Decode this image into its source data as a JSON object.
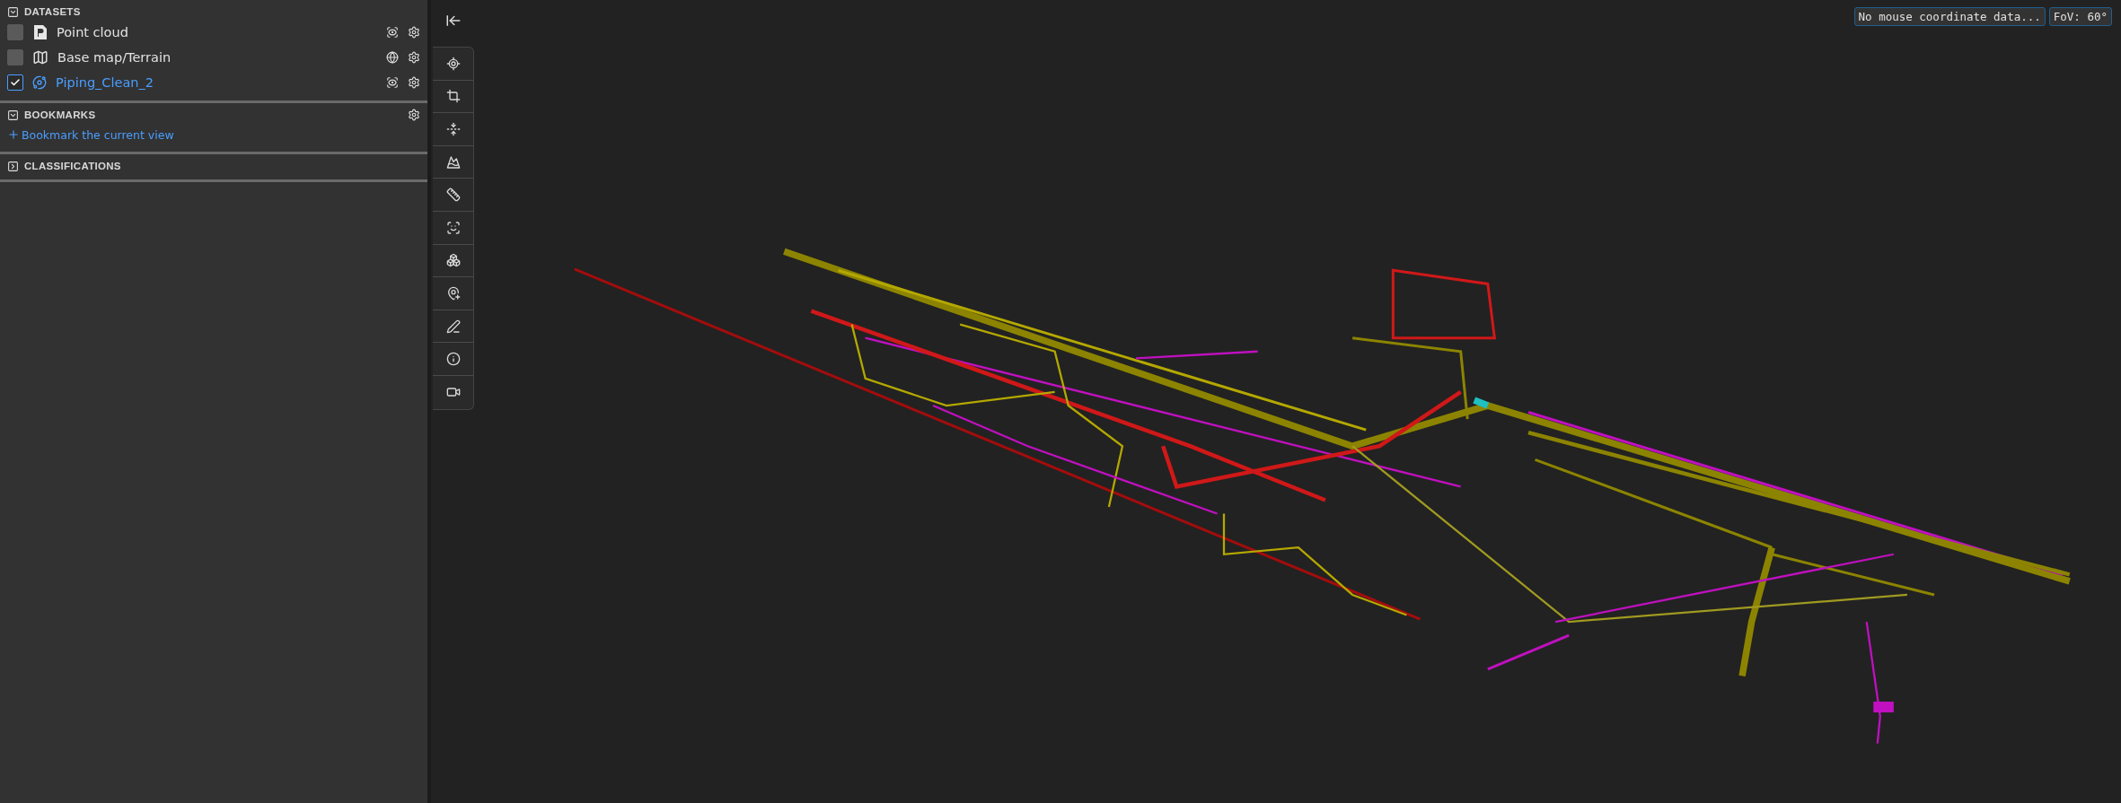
{
  "sidebar": {
    "sections": [
      {
        "kind": "datasets",
        "title": "DATASETS",
        "expanded": true,
        "items": [
          {
            "kind": "point-cloud",
            "label": "Point cloud",
            "checked": false
          },
          {
            "kind": "terrain",
            "label": "Base map/Terrain",
            "checked": false
          },
          {
            "kind": "model",
            "label": "Piping_Clean_2",
            "checked": true
          }
        ]
      },
      {
        "kind": "bookmarks",
        "title": "BOOKMARKS",
        "expanded": true,
        "link": "Bookmark the current view"
      },
      {
        "kind": "classifications",
        "title": "CLASSIFICATIONS",
        "expanded": false
      }
    ]
  },
  "viewport": {
    "coordinates": "No mouse coordinate data...",
    "fov": "FoV: 60°"
  }
}
